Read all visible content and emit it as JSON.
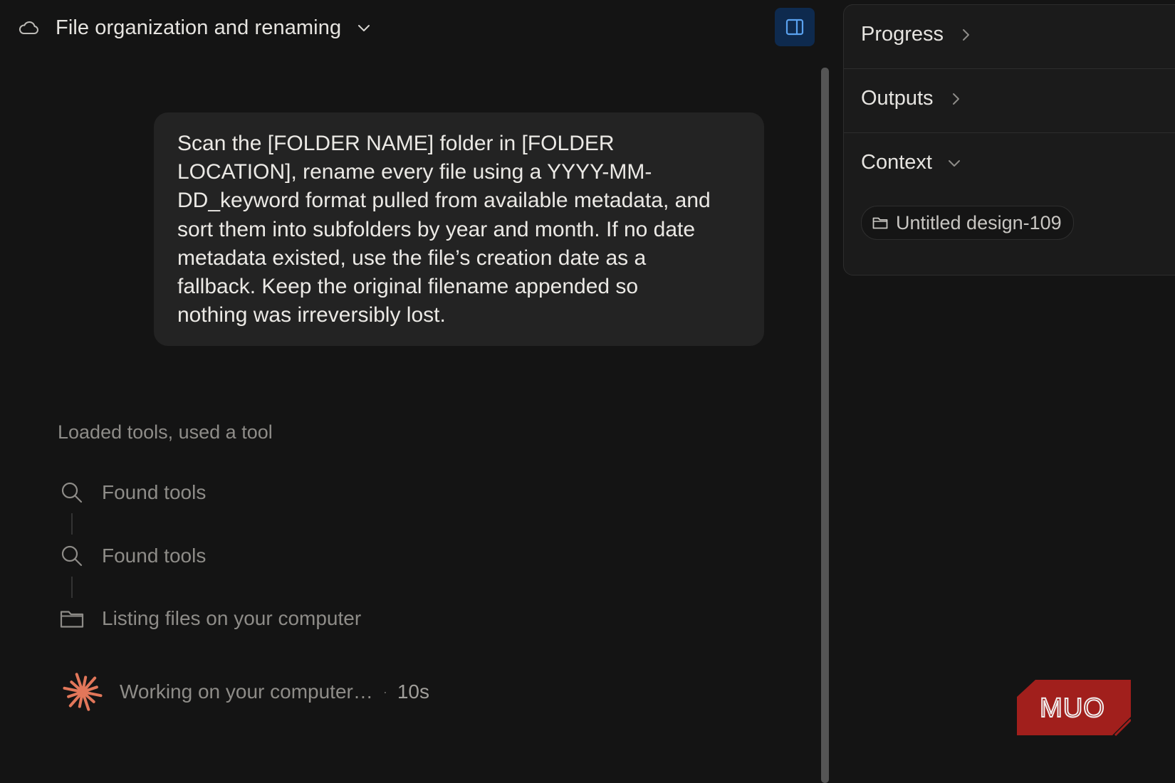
{
  "header": {
    "title": "File organization and renaming"
  },
  "chat": {
    "user_message_lines": [
      "Scan the [FOLDER NAME] folder in [FOLDER",
      "LOCATION], rename every file using a YYYY-MM-",
      "DD_keyword format pulled from available metadata, and",
      "sort them into subfolders by year and month. If no date",
      "metadata existed, use the file’s creation date as a",
      "fallback. Keep the original filename appended so",
      "nothing was irreversibly lost."
    ],
    "activity_summary": "Loaded tools, used a tool",
    "steps": [
      {
        "label": "Found tools",
        "icon": "search-icon"
      },
      {
        "label": "Found tools",
        "icon": "search-icon"
      },
      {
        "label": "Listing files on your computer",
        "icon": "folder-icon"
      }
    ],
    "working": {
      "label": "Working on your computer…",
      "separator": "·",
      "elapsed": "10s"
    }
  },
  "right_panel": {
    "progress_label": "Progress",
    "outputs_label": "Outputs",
    "context_label": "Context",
    "context_chip": "Untitled design-109"
  },
  "watermark": "MUO",
  "colors": {
    "background": "#141414",
    "bubble": "#232323",
    "accent_toggle": "#0e2a4e",
    "accent_icon": "#5aa2f0",
    "spark": "#e2775a",
    "watermark_bg": "#a11f1c"
  }
}
